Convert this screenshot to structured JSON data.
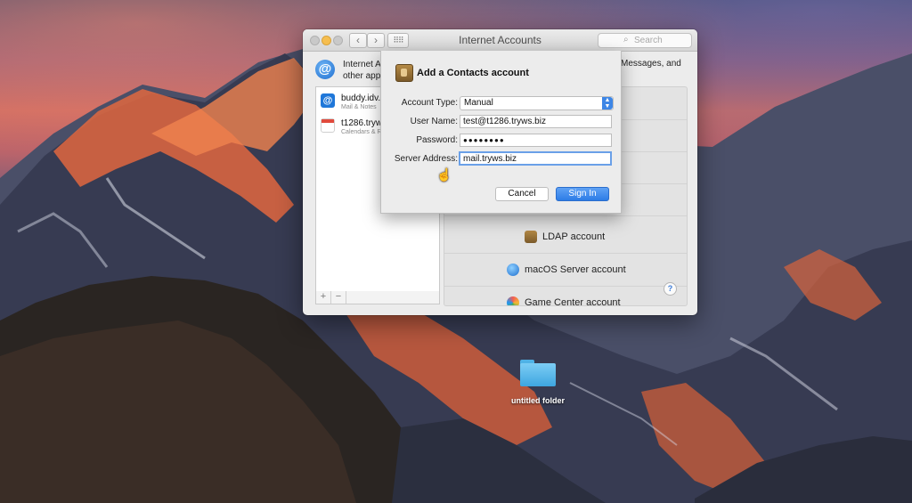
{
  "window": {
    "title": "Internet Accounts",
    "search_placeholder": "Search",
    "header_left": "Internet Ac\nother apps",
    "header_right": "Messages, and"
  },
  "accounts": [
    {
      "name": "buddy.idv.hk",
      "subtitle": "Mail & Notes"
    },
    {
      "name": "t1286.tryws.",
      "subtitle": "Calendars & R"
    }
  ],
  "sidebar_buttons": {
    "add": "+",
    "remove": "−"
  },
  "providers": [
    {
      "label": "LDAP account",
      "icon": "ldap-icon"
    },
    {
      "label": "macOS Server account",
      "icon": "macos-server-icon"
    },
    {
      "label": "Game Center account",
      "icon": "game-center-icon"
    }
  ],
  "help_label": "?",
  "sheet": {
    "title": "Add a Contacts account",
    "account_type_label": "Account Type:",
    "account_type_value": "Manual",
    "username_label": "User Name:",
    "username_value": "test@t1286.tryws.biz",
    "password_label": "Password:",
    "password_value": "●●●●●●●●",
    "server_label": "Server Address:",
    "server_value": "mail.tryws.biz",
    "cancel_label": "Cancel",
    "signin_label": "Sign In"
  },
  "desktop": {
    "folder_label": "untitled folder"
  },
  "colors": {
    "accent": "#2d7ce6",
    "window_bg": "#ececec"
  }
}
